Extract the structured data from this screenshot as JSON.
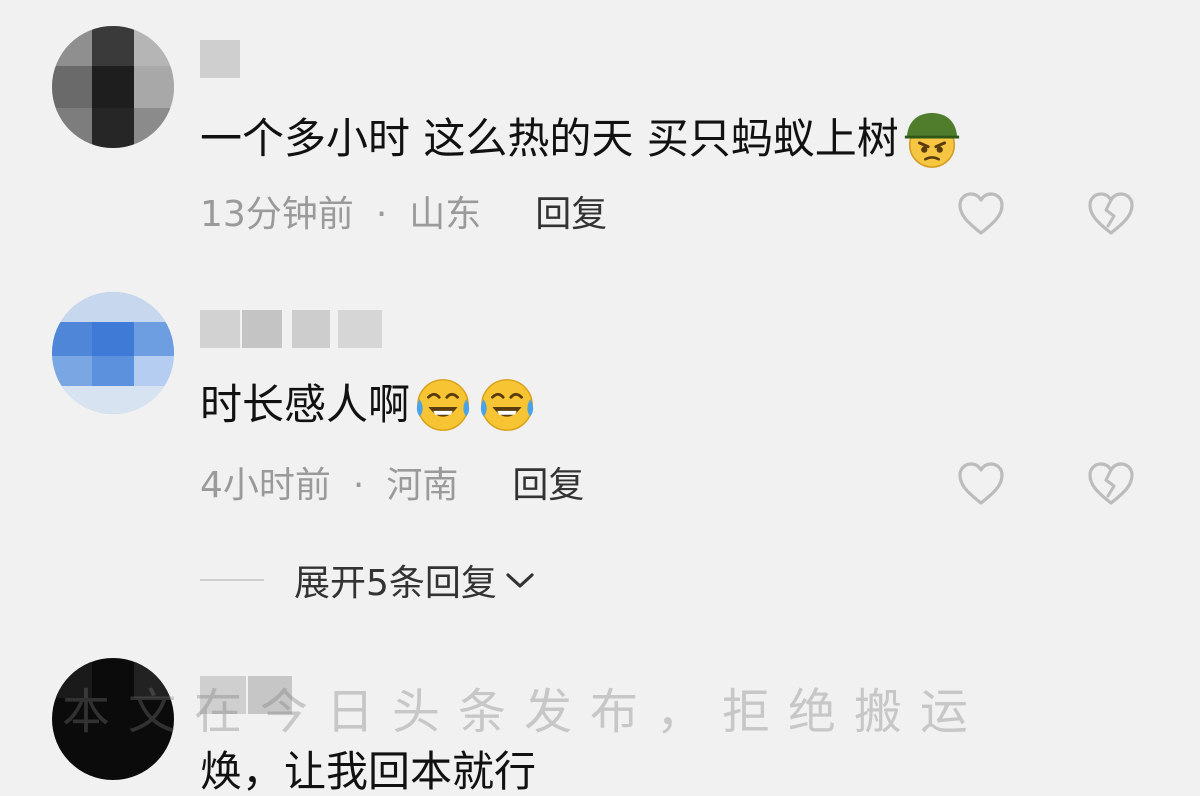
{
  "comments": [
    {
      "text": "一个多小时 这么热的天 买只蚂蚁上树",
      "emojis": [
        "army-helmet-angry-face-emoji"
      ],
      "time": "13分钟前",
      "separator": "·",
      "region": "山东",
      "reply_label": "回复"
    },
    {
      "text": "时长感人啊",
      "emojis": [
        "crying-laughing-face-emoji",
        "crying-laughing-face-emoji"
      ],
      "time": "4小时前",
      "separator": "·",
      "region": "河南",
      "reply_label": "回复",
      "expand_label": "展开5条回复"
    },
    {
      "text": "焕，让我回本就行"
    }
  ],
  "watermark": "本文在今日头条发布，拒绝搬运",
  "colors": {
    "background": "#f1f1f1",
    "meta_text": "#9a9a9a",
    "icon_stroke": "#c4c4c4"
  }
}
